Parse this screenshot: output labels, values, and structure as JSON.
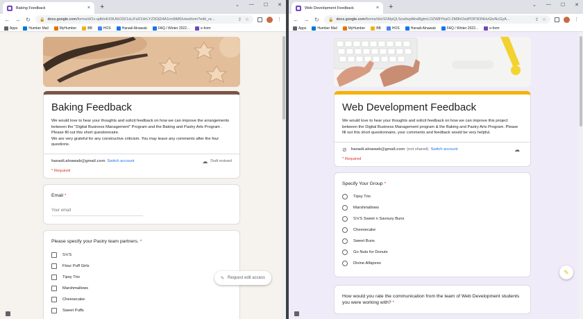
{
  "left": {
    "tab": {
      "title": "Baking Feedback",
      "close": "×",
      "favicon_color": "#7248b9"
    },
    "new_tab": "+",
    "window_controls": [
      "⌄",
      "—",
      "☐",
      "✕"
    ],
    "url_host": "docs.google.com",
    "url_path": "/forms/d/1v-qdbIxKX9UIkO3X1xLiFsD1HrLYZ3OjD4A1rm9iM0/viewform?edit_re...",
    "bookmarks": [
      {
        "label": "Apps",
        "color": "#5f6368"
      },
      {
        "label": "Humber Mail",
        "color": "#0078d4"
      },
      {
        "label": "MyHumber",
        "color": "#e37400"
      },
      {
        "label": "BB",
        "color": "#f2b01e"
      },
      {
        "label": "HOS",
        "color": "#4285f4"
      },
      {
        "label": "Hanadi Alnawab",
        "color": "#1a73e8"
      },
      {
        "label": "FAQ / Winter 2022...",
        "color": "#1a73e8"
      },
      {
        "label": "e-form",
        "color": "#7248b9"
      }
    ],
    "form": {
      "title": "Baking Feedback",
      "description": "We would love to hear your thoughts and solicit feedback on how we can improve the arrangements between the \"Digital Business Management\" Program and the Baking and Pastry Arts Program . Please fill out this short questionnaire.\n                  We are very grateful for any constructive criticism. You may leave any comments after the four questions.",
      "account_email": "hanadi.alnawab@gmail.com",
      "switch_account": "Switch account",
      "draft_status": "Draft restored",
      "required_note": "* Required",
      "email_question": {
        "label": "Email",
        "star": "*",
        "placeholder": "Your email"
      },
      "pastry_question": {
        "label": "Please specify your Pastry team partners.",
        "star": "*",
        "options": [
          "S'n'S",
          "Flour Puff Girls",
          "Tipsy Trio",
          "Marshmallows",
          "Cheesecake",
          "Sweet Puffs"
        ]
      }
    },
    "request_edit": "Request edit access"
  },
  "right": {
    "tab": {
      "title": "Web Development Feedback",
      "close": "×",
      "favicon_color": "#7248b9"
    },
    "new_tab": "+",
    "window_controls": [
      "⌄",
      "—",
      "☐",
      "✕"
    ],
    "url_host": "docs.google.com",
    "url_path": "/forms/d/e/1FAIpQLScwfwpMnd8gtmLOZW8YhpO-2M9hOxdPOP3ONHvGtvNcGyA...",
    "bookmarks": [
      {
        "label": "Apps",
        "color": "#5f6368"
      },
      {
        "label": "Humber Mail",
        "color": "#0078d4"
      },
      {
        "label": "MyHumber",
        "color": "#e37400"
      },
      {
        "label": "BB",
        "color": "#f2b01e"
      },
      {
        "label": "HOS",
        "color": "#4285f4"
      },
      {
        "label": "Hanadi Alnawab",
        "color": "#1a73e8"
      },
      {
        "label": "FAQ / Winter 2022...",
        "color": "#1a73e8"
      },
      {
        "label": "e-form",
        "color": "#7248b9"
      }
    ],
    "form": {
      "title": "Web Development Feedback",
      "description": "We would love to hear your thoughts and solicit feedback on how we can improve this project between the Digital Business Management program & the Baking and Pastry Arts Program. Please fill out this short questionnaire, your comments and feedback would be very helpful.",
      "account_email": "hanadi.alnawab@gmail.com",
      "not_shared": "(not shared)",
      "switch_account": "Switch account",
      "required_note": "* Required",
      "group_question": {
        "label": "Specify Your Group",
        "star": "*",
        "options": [
          "Tipsy Trio",
          "Marshmallows",
          "S'n'S Sweet n Savoury Buns",
          "Cheesecake",
          "Sweet Buns",
          "Go Nuts for Donuts",
          "Divine Alfajores"
        ]
      },
      "rating_question": {
        "label": "How would you rate the communication from the team of Web Development students you were working with?",
        "star": "*"
      }
    }
  },
  "colors": {
    "left_bg": "#f6f2ed",
    "right_bg": "#f0ebf8",
    "link": "#1a73e8",
    "required": "#d93025"
  }
}
